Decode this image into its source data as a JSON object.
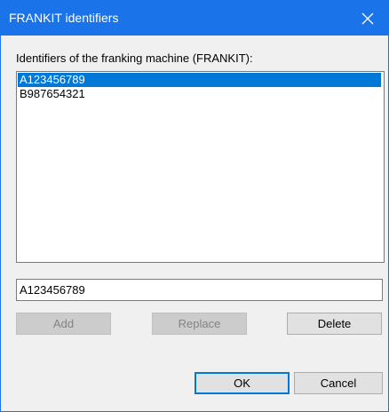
{
  "window": {
    "title": "FRANKIT identifiers",
    "close_icon": "close-icon"
  },
  "identifiers_label": "Identifiers of the franking machine (FRANKIT):",
  "identifiers_list": [
    {
      "value": "A123456789",
      "selected": true
    },
    {
      "value": "B987654321",
      "selected": false
    }
  ],
  "identifier_input": {
    "value": "A123456789"
  },
  "buttons": {
    "add": "Add",
    "replace": "Replace",
    "delete": "Delete",
    "ok": "OK",
    "cancel": "Cancel"
  },
  "colors": {
    "titlebar": "#1a73e8",
    "selection": "#0078d7"
  }
}
